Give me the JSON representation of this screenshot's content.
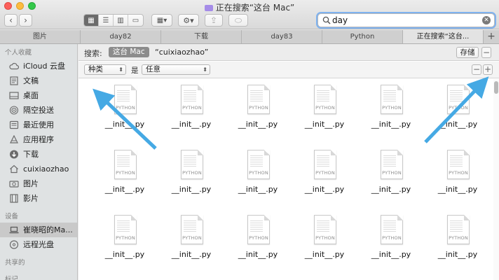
{
  "window": {
    "title": "正在搜索“这台 Mac”"
  },
  "toolbar": {
    "back_icon": "chevron-left-icon",
    "forward_icon": "chevron-right-icon",
    "views": [
      "icon-view",
      "list-view",
      "column-view",
      "gallery-view"
    ],
    "group_icon": "group-by-icon",
    "action_icon": "gear-icon",
    "share_icon": "share-icon",
    "tag_icon": "tag-icon"
  },
  "search": {
    "value": "day",
    "icon": "search-icon",
    "clear_icon": "clear-icon"
  },
  "tabs": [
    {
      "label": "图片"
    },
    {
      "label": "day82"
    },
    {
      "label": "下载"
    },
    {
      "label": "day83"
    },
    {
      "label": "Python"
    },
    {
      "label": "正在搜索“这台..."
    }
  ],
  "tab_add": "+",
  "sidebar": {
    "favorites_title": "个人收藏",
    "favorites": [
      {
        "label": "iCloud 云盘",
        "icon": "cloud-icon"
      },
      {
        "label": "文稿",
        "icon": "document-icon"
      },
      {
        "label": "桌面",
        "icon": "desktop-icon"
      },
      {
        "label": "隔空投送",
        "icon": "airdrop-icon"
      },
      {
        "label": "最近使用",
        "icon": "clock-icon"
      },
      {
        "label": "应用程序",
        "icon": "apps-icon"
      },
      {
        "label": "下载",
        "icon": "download-icon"
      },
      {
        "label": "cuixiaozhao",
        "icon": "home-icon"
      },
      {
        "label": "图片",
        "icon": "camera-icon"
      },
      {
        "label": "影片",
        "icon": "film-icon"
      }
    ],
    "devices_title": "设备",
    "devices": [
      {
        "label": "崔晓昭的Ma...",
        "icon": "laptop-icon"
      },
      {
        "label": "远程光盘",
        "icon": "disc-icon"
      }
    ],
    "shared_title": "共享的",
    "tags_title": "标记"
  },
  "scope": {
    "label": "搜索:",
    "this_mac": "这台 Mac",
    "user": "“cuixiaozhao”",
    "save": "存储",
    "minus": "−"
  },
  "criteria": {
    "kind": "种类",
    "is": "是",
    "any": "任意",
    "minus": "−",
    "plus": "+"
  },
  "files": [
    "__init__.py",
    "__init__.py",
    "__init__.py",
    "__init__.py",
    "__init__.py",
    "__init__.py",
    "__init__.py",
    "__init__.py",
    "__init__.py",
    "__init__.py",
    "__init__.py",
    "__init__.py",
    "__init__.py",
    "__init__.py",
    "__init__.py",
    "__init__.py",
    "__init__.py",
    "__init__.py"
  ],
  "file_kind_label": "PYTHON",
  "colors": {
    "accent": "#7fb2ef",
    "arrow": "#45a9e4",
    "sidebar": "#dfe2e3"
  }
}
